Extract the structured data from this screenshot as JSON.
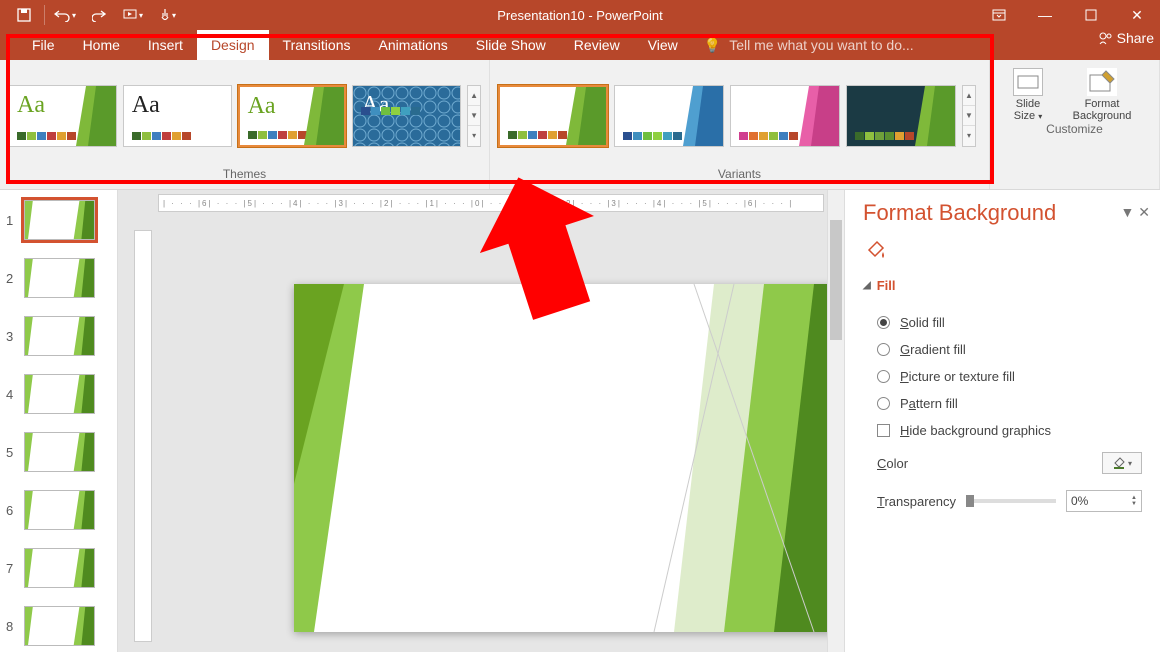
{
  "app": {
    "title": "Presentation10 - PowerPoint"
  },
  "qat": {
    "save": "save-icon",
    "undo": "undo-icon",
    "redo": "redo-icon",
    "start": "start-from-beginning-icon",
    "touch": "touch-mode-icon"
  },
  "tabs": {
    "items": [
      "File",
      "Home",
      "Insert",
      "Design",
      "Transitions",
      "Animations",
      "Slide Show",
      "Review",
      "View"
    ],
    "active": "Design",
    "tellme": "Tell me what you want to do...",
    "share": "Share"
  },
  "ribbon": {
    "themes_label": "Themes",
    "variants_label": "Variants",
    "customize_label": "Customize",
    "slide_size": "Slide Size",
    "format_bg": "Format Background",
    "theme_swatch_colors": [
      "#3a6b2a",
      "#8fbf3f",
      "#3f7fbf",
      "#bf3f3f",
      "#e0a030",
      "#b7472a"
    ],
    "variant_sets": {
      "green": [
        "#3a6b2a",
        "#8fbf3f",
        "#3f7fbf",
        "#bf3f3f",
        "#e0a030",
        "#b7472a"
      ],
      "blue": [
        "#2a4f8f",
        "#3f8fbf",
        "#6fbf3f",
        "#8fd040",
        "#3fa0bf",
        "#2a6b8f"
      ],
      "pink": [
        "#d03f8f",
        "#e07030",
        "#e0a030",
        "#8fbf3f",
        "#3f7fbf",
        "#b7472a"
      ],
      "dark": [
        "#3a6b2a",
        "#8fbf3f",
        "#6fa03a",
        "#5a8f30",
        "#e0a030",
        "#b7472a"
      ]
    }
  },
  "ruler": "| · · · |6| · · · |5| · · · |4| · · · |3| · · · |2| · · · |1| · · · |0| · · · |1| · · · |2| · · · |3| · · · |4| · · · |5| · · · |6| · · · |",
  "thumbs": {
    "count": 8,
    "selected": 1
  },
  "formatPane": {
    "title": "Format Background",
    "section": "Fill",
    "options": {
      "solid": "Solid fill",
      "gradient": "Gradient fill",
      "picture": "Picture or texture fill",
      "pattern": "Pattern fill",
      "hide": "Hide background graphics"
    },
    "color_label": "Color",
    "transparency_label": "Transparency",
    "transparency_value": "0%"
  }
}
